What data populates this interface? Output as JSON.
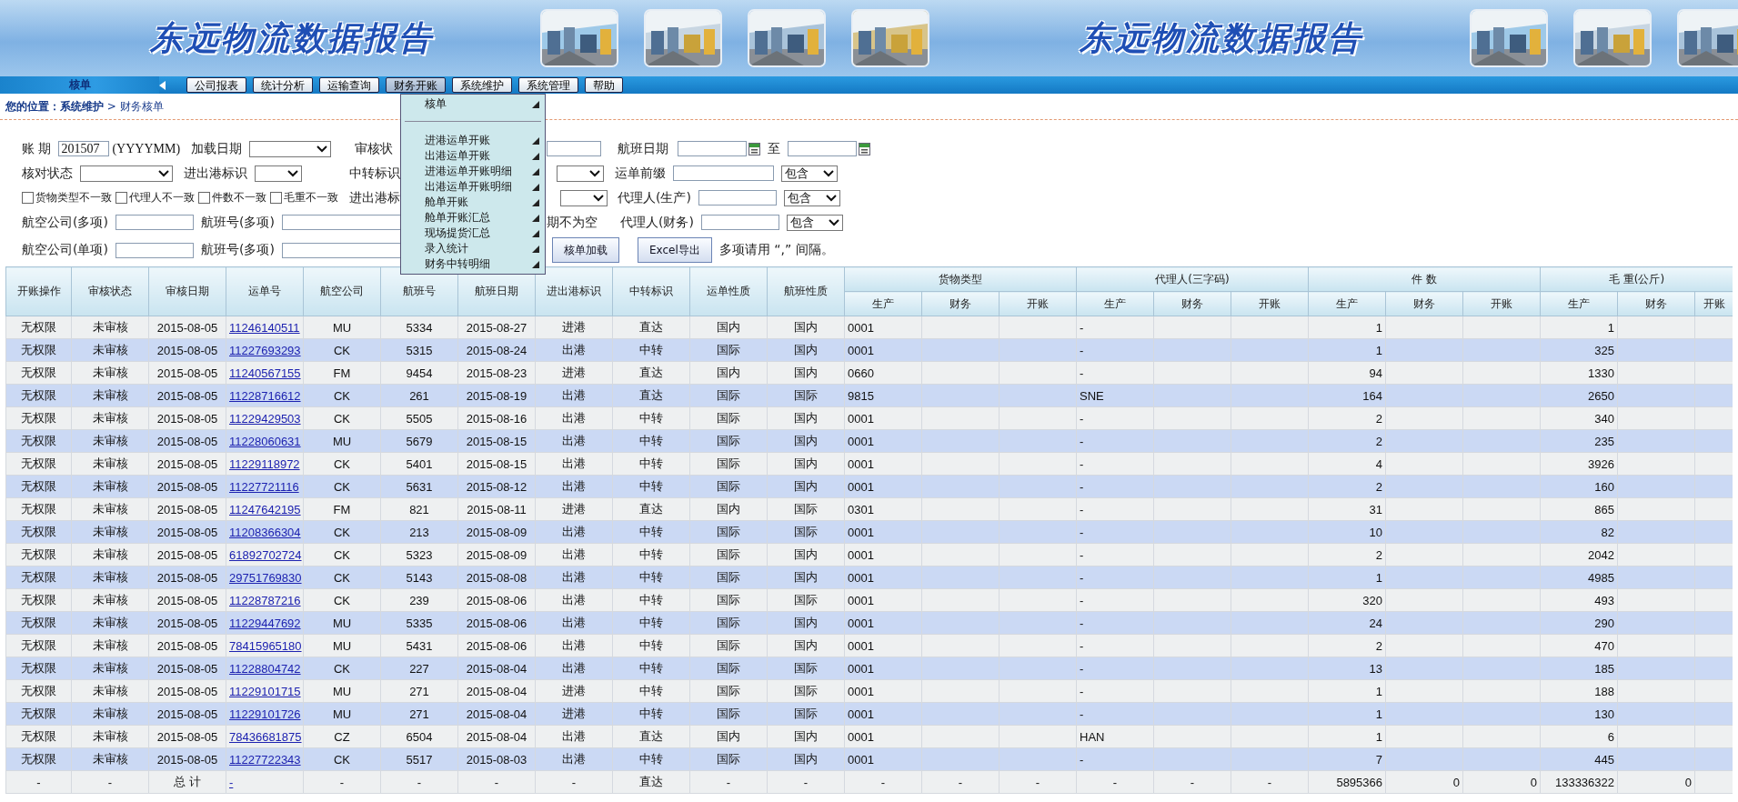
{
  "banner": [
    {
      "title": "东远物流数据报告"
    },
    {
      "title": "东远物流数据报告"
    }
  ],
  "nav": {
    "section": "核单",
    "tabs": [
      {
        "label": "公司报表",
        "selected": false
      },
      {
        "label": "统计分析",
        "selected": false
      },
      {
        "label": "运输查询",
        "selected": false
      },
      {
        "label": "财务开账",
        "selected": true
      },
      {
        "label": "系统维护",
        "selected": false
      },
      {
        "label": "系统管理",
        "selected": false
      },
      {
        "label": "帮助",
        "selected": false
      }
    ]
  },
  "menu": [
    {
      "kind": "item",
      "label": "核单"
    },
    {
      "kind": "separator"
    },
    {
      "kind": "item",
      "label": "进港运单开账"
    },
    {
      "kind": "item",
      "label": "出港运单开账"
    },
    {
      "kind": "item",
      "label": "进港运单开账明细"
    },
    {
      "kind": "item",
      "label": "出港运单开账明细"
    },
    {
      "kind": "item",
      "label": "舱单开账"
    },
    {
      "kind": "item",
      "label": "舱单开账汇总"
    },
    {
      "kind": "item",
      "label": "现场提货汇总"
    },
    {
      "kind": "item",
      "label": "录入统计"
    },
    {
      "kind": "item",
      "label": "财务中转明细"
    }
  ],
  "breadcrumb": "**您的位置：系统维护** > 财务核单",
  "filters": [
    {
      "left": [
        {
          "kind": "label",
          "text": "账 期"
        },
        {
          "kind": "input",
          "value": "201507"
        },
        {
          "kind": "note",
          "text": "(YYYYMM)"
        },
        {
          "kind": "label",
          "text": "加载日期"
        },
        {
          "kind": "select"
        },
        {
          "kind": "label",
          "text": "审核状"
        }
      ],
      "right": [
        {
          "kind": "input"
        },
        {
          "kind": "label",
          "text": "航班日期"
        },
        {
          "kind": "date"
        },
        {
          "kind": "label",
          "text": "至"
        },
        {
          "kind": "date"
        }
      ]
    },
    {
      "left": [
        {
          "kind": "label",
          "text": "核对状态"
        },
        {
          "kind": "select"
        },
        {
          "kind": "label",
          "text": "进出港标识"
        },
        {
          "kind": "select"
        },
        {
          "kind": "label",
          "text": "中转标识"
        }
      ],
      "right": [
        {
          "kind": "select"
        },
        {
          "kind": "label",
          "text": "运单前缀"
        },
        {
          "kind": "input"
        },
        {
          "kind": "select",
          "value": "包含"
        }
      ]
    },
    {
      "left": [
        {
          "kind": "checkbox",
          "text": "货物类型不一致",
          "checked": false
        },
        {
          "kind": "checkbox",
          "text": "代理人不一致",
          "checked": false
        },
        {
          "kind": "checkbox",
          "text": "件数不一致",
          "checked": false
        },
        {
          "kind": "checkbox",
          "text": "毛重不一致",
          "checked": false
        },
        {
          "kind": "label",
          "text": "进出港标"
        }
      ],
      "right": [
        {
          "kind": "select"
        },
        {
          "kind": "label",
          "text": "代理人(生产)"
        },
        {
          "kind": "input"
        },
        {
          "kind": "select",
          "value": "包含"
        }
      ]
    },
    {
      "left": [
        {
          "kind": "label",
          "text": "航空公司(多项)"
        },
        {
          "kind": "input"
        },
        {
          "kind": "label",
          "text": "航班号(多项)"
        },
        {
          "kind": "input"
        }
      ],
      "right": [
        {
          "kind": "label",
          "text": "期不为空"
        },
        {
          "kind": "label",
          "text": "代理人(财务)"
        },
        {
          "kind": "input"
        },
        {
          "kind": "select",
          "value": "包含"
        }
      ]
    },
    {
      "left": [
        {
          "kind": "label",
          "text": "航空公司(单项)"
        },
        {
          "kind": "input"
        },
        {
          "kind": "label",
          "text": "航班号(多项)"
        },
        {
          "kind": "input"
        }
      ],
      "right": [
        {
          "kind": "button",
          "text": "核单加载"
        },
        {
          "kind": "button",
          "text": "Excel导出"
        },
        {
          "kind": "label",
          "text": "多项请用 “,” 间隔。"
        }
      ]
    }
  ],
  "table": {
    "columns": [
      "开账操作",
      "审核状态",
      "审核日期",
      "运单号",
      "航空公司",
      "航班号",
      "航班日期",
      "进出港标识",
      "中转标识",
      "运单性质",
      "航班性质"
    ],
    "groups": [
      {
        "label": "货物类型",
        "sub": [
          "生产",
          "财务",
          "开账"
        ]
      },
      {
        "label": "代理人(三字码)",
        "sub": [
          "生产",
          "财务",
          "开账"
        ]
      },
      {
        "label": "件 数",
        "sub": [
          "生产",
          "财务",
          "开账"
        ]
      },
      {
        "label": "毛 重(公斤)",
        "sub": [
          "生产",
          "财务",
          "开账"
        ]
      }
    ],
    "rows": [
      {
        "operation": "无权限",
        "status": "未审核",
        "audit_date": "2015-08-05",
        "waybill": "11246140511",
        "airline": "MU",
        "flight_no": "5334",
        "flight_date": "2015-08-27",
        "direction": "进港",
        "transfer": "直达",
        "waybill_nature": "国内",
        "flight_nature": "国内",
        "cargo_production": "0001",
        "agent_production": "-",
        "pieces_production": "1",
        "weight_production": "1"
      },
      {
        "operation": "无权限",
        "status": "未审核",
        "audit_date": "2015-08-05",
        "waybill": "11227693293",
        "airline": "CK",
        "flight_no": "5315",
        "flight_date": "2015-08-24",
        "direction": "出港",
        "transfer": "中转",
        "waybill_nature": "国际",
        "flight_nature": "国内",
        "cargo_production": "0001",
        "agent_production": "-",
        "pieces_production": "1",
        "weight_production": "325"
      },
      {
        "operation": "无权限",
        "status": "未审核",
        "audit_date": "2015-08-05",
        "waybill": "11240567155",
        "airline": "FM",
        "flight_no": "9454",
        "flight_date": "2015-08-23",
        "direction": "进港",
        "transfer": "直达",
        "waybill_nature": "国内",
        "flight_nature": "国内",
        "cargo_production": "0660",
        "agent_production": "-",
        "pieces_production": "94",
        "weight_production": "1330"
      },
      {
        "operation": "无权限",
        "status": "未审核",
        "audit_date": "2015-08-05",
        "waybill": "11228716612",
        "airline": "CK",
        "flight_no": "261",
        "flight_date": "2015-08-19",
        "direction": "出港",
        "transfer": "直达",
        "waybill_nature": "国际",
        "flight_nature": "国际",
        "cargo_production": "9815",
        "agent_production": "SNE",
        "pieces_production": "164",
        "weight_production": "2650"
      },
      {
        "operation": "无权限",
        "status": "未审核",
        "audit_date": "2015-08-05",
        "waybill": "11229429503",
        "airline": "CK",
        "flight_no": "5505",
        "flight_date": "2015-08-16",
        "direction": "出港",
        "transfer": "中转",
        "waybill_nature": "国际",
        "flight_nature": "国内",
        "cargo_production": "0001",
        "agent_production": "-",
        "pieces_production": "2",
        "weight_production": "340"
      },
      {
        "operation": "无权限",
        "status": "未审核",
        "audit_date": "2015-08-05",
        "waybill": "11228060631",
        "airline": "MU",
        "flight_no": "5679",
        "flight_date": "2015-08-15",
        "direction": "出港",
        "transfer": "中转",
        "waybill_nature": "国际",
        "flight_nature": "国内",
        "cargo_production": "0001",
        "agent_production": "-",
        "pieces_production": "2",
        "weight_production": "235"
      },
      {
        "operation": "无权限",
        "status": "未审核",
        "audit_date": "2015-08-05",
        "waybill": "11229118972",
        "airline": "CK",
        "flight_no": "5401",
        "flight_date": "2015-08-15",
        "direction": "出港",
        "transfer": "中转",
        "waybill_nature": "国际",
        "flight_nature": "国内",
        "cargo_production": "0001",
        "agent_production": "-",
        "pieces_production": "4",
        "weight_production": "3926"
      },
      {
        "operation": "无权限",
        "status": "未审核",
        "audit_date": "2015-08-05",
        "waybill": "11227721116",
        "airline": "CK",
        "flight_no": "5631",
        "flight_date": "2015-08-12",
        "direction": "出港",
        "transfer": "中转",
        "waybill_nature": "国际",
        "flight_nature": "国内",
        "cargo_production": "0001",
        "agent_production": "-",
        "pieces_production": "2",
        "weight_production": "160"
      },
      {
        "operation": "无权限",
        "status": "未审核",
        "audit_date": "2015-08-05",
        "waybill": "11247642195",
        "airline": "FM",
        "flight_no": "821",
        "flight_date": "2015-08-11",
        "direction": "进港",
        "transfer": "直达",
        "waybill_nature": "国内",
        "flight_nature": "国际",
        "cargo_production": "0301",
        "agent_production": "-",
        "pieces_production": "31",
        "weight_production": "865"
      },
      {
        "operation": "无权限",
        "status": "未审核",
        "audit_date": "2015-08-05",
        "waybill": "11208366304",
        "airline": "CK",
        "flight_no": "213",
        "flight_date": "2015-08-09",
        "direction": "出港",
        "transfer": "中转",
        "waybill_nature": "国际",
        "flight_nature": "国际",
        "cargo_production": "0001",
        "agent_production": "-",
        "pieces_production": "10",
        "weight_production": "82"
      },
      {
        "operation": "无权限",
        "status": "未审核",
        "audit_date": "2015-08-05",
        "waybill": "61892702724",
        "airline": "CK",
        "flight_no": "5323",
        "flight_date": "2015-08-09",
        "direction": "出港",
        "transfer": "中转",
        "waybill_nature": "国际",
        "flight_nature": "国内",
        "cargo_production": "0001",
        "agent_production": "-",
        "pieces_production": "2",
        "weight_production": "2042"
      },
      {
        "operation": "无权限",
        "status": "未审核",
        "audit_date": "2015-08-05",
        "waybill": "29751769830",
        "airline": "CK",
        "flight_no": "5143",
        "flight_date": "2015-08-08",
        "direction": "出港",
        "transfer": "中转",
        "waybill_nature": "国际",
        "flight_nature": "国内",
        "cargo_production": "0001",
        "agent_production": "-",
        "pieces_production": "1",
        "weight_production": "4985"
      },
      {
        "operation": "无权限",
        "status": "未审核",
        "audit_date": "2015-08-05",
        "waybill": "11228787216",
        "airline": "CK",
        "flight_no": "239",
        "flight_date": "2015-08-06",
        "direction": "出港",
        "transfer": "中转",
        "waybill_nature": "国际",
        "flight_nature": "国际",
        "cargo_production": "0001",
        "agent_production": "-",
        "pieces_production": "320",
        "weight_production": "493"
      },
      {
        "operation": "无权限",
        "status": "未审核",
        "audit_date": "2015-08-05",
        "waybill": "11229447692",
        "airline": "MU",
        "flight_no": "5335",
        "flight_date": "2015-08-06",
        "direction": "出港",
        "transfer": "中转",
        "waybill_nature": "国际",
        "flight_nature": "国内",
        "cargo_production": "0001",
        "agent_production": "-",
        "pieces_production": "24",
        "weight_production": "290"
      },
      {
        "operation": "无权限",
        "status": "未审核",
        "audit_date": "2015-08-05",
        "waybill": "78415965180",
        "airline": "MU",
        "flight_no": "5431",
        "flight_date": "2015-08-06",
        "direction": "出港",
        "transfer": "中转",
        "waybill_nature": "国际",
        "flight_nature": "国内",
        "cargo_production": "0001",
        "agent_production": "-",
        "pieces_production": "2",
        "weight_production": "470"
      },
      {
        "operation": "无权限",
        "status": "未审核",
        "audit_date": "2015-08-05",
        "waybill": "11228804742",
        "airline": "CK",
        "flight_no": "227",
        "flight_date": "2015-08-04",
        "direction": "出港",
        "transfer": "中转",
        "waybill_nature": "国际",
        "flight_nature": "国际",
        "cargo_production": "0001",
        "agent_production": "-",
        "pieces_production": "13",
        "weight_production": "185"
      },
      {
        "operation": "无权限",
        "status": "未审核",
        "audit_date": "2015-08-05",
        "waybill": "11229101715",
        "airline": "MU",
        "flight_no": "271",
        "flight_date": "2015-08-04",
        "direction": "进港",
        "transfer": "中转",
        "waybill_nature": "国际",
        "flight_nature": "国际",
        "cargo_production": "0001",
        "agent_production": "-",
        "pieces_production": "1",
        "weight_production": "188"
      },
      {
        "operation": "无权限",
        "status": "未审核",
        "audit_date": "2015-08-05",
        "waybill": "11229101726",
        "airline": "MU",
        "flight_no": "271",
        "flight_date": "2015-08-04",
        "direction": "进港",
        "transfer": "中转",
        "waybill_nature": "国际",
        "flight_nature": "国际",
        "cargo_production": "0001",
        "agent_production": "-",
        "pieces_production": "1",
        "weight_production": "130"
      },
      {
        "operation": "无权限",
        "status": "未审核",
        "audit_date": "2015-08-05",
        "waybill": "78436681875",
        "airline": "CZ",
        "flight_no": "6504",
        "flight_date": "2015-08-04",
        "direction": "出港",
        "transfer": "直达",
        "waybill_nature": "国内",
        "flight_nature": "国内",
        "cargo_production": "0001",
        "agent_production": "HAN",
        "pieces_production": "1",
        "weight_production": "6"
      },
      {
        "operation": "无权限",
        "status": "未审核",
        "audit_date": "2015-08-05",
        "waybill": "11227722343",
        "airline": "CK",
        "flight_no": "5517",
        "flight_date": "2015-08-03",
        "direction": "出港",
        "transfer": "中转",
        "waybill_nature": "国际",
        "flight_nature": "国内",
        "cargo_production": "0001",
        "agent_production": "-",
        "pieces_production": "7",
        "weight_production": "445"
      }
    ],
    "total": {
      "operation": "-",
      "status": "-",
      "audit_date": "总 计",
      "waybill": "-",
      "airline": "-",
      "flight_no": "-",
      "flight_date": "-",
      "direction": "-",
      "transfer": "直达",
      "waybill_nature": "-",
      "flight_nature": "-",
      "cargo_production": "-",
      "cargo_finance": "-",
      "cargo_billing": "-",
      "agent_production": "-",
      "agent_finance": "-",
      "agent_billing": "-",
      "pieces_production": "5895366",
      "pieces_finance": "0",
      "pieces_billing": "0",
      "weight_production": "133336322",
      "weight_finance": "0"
    }
  }
}
